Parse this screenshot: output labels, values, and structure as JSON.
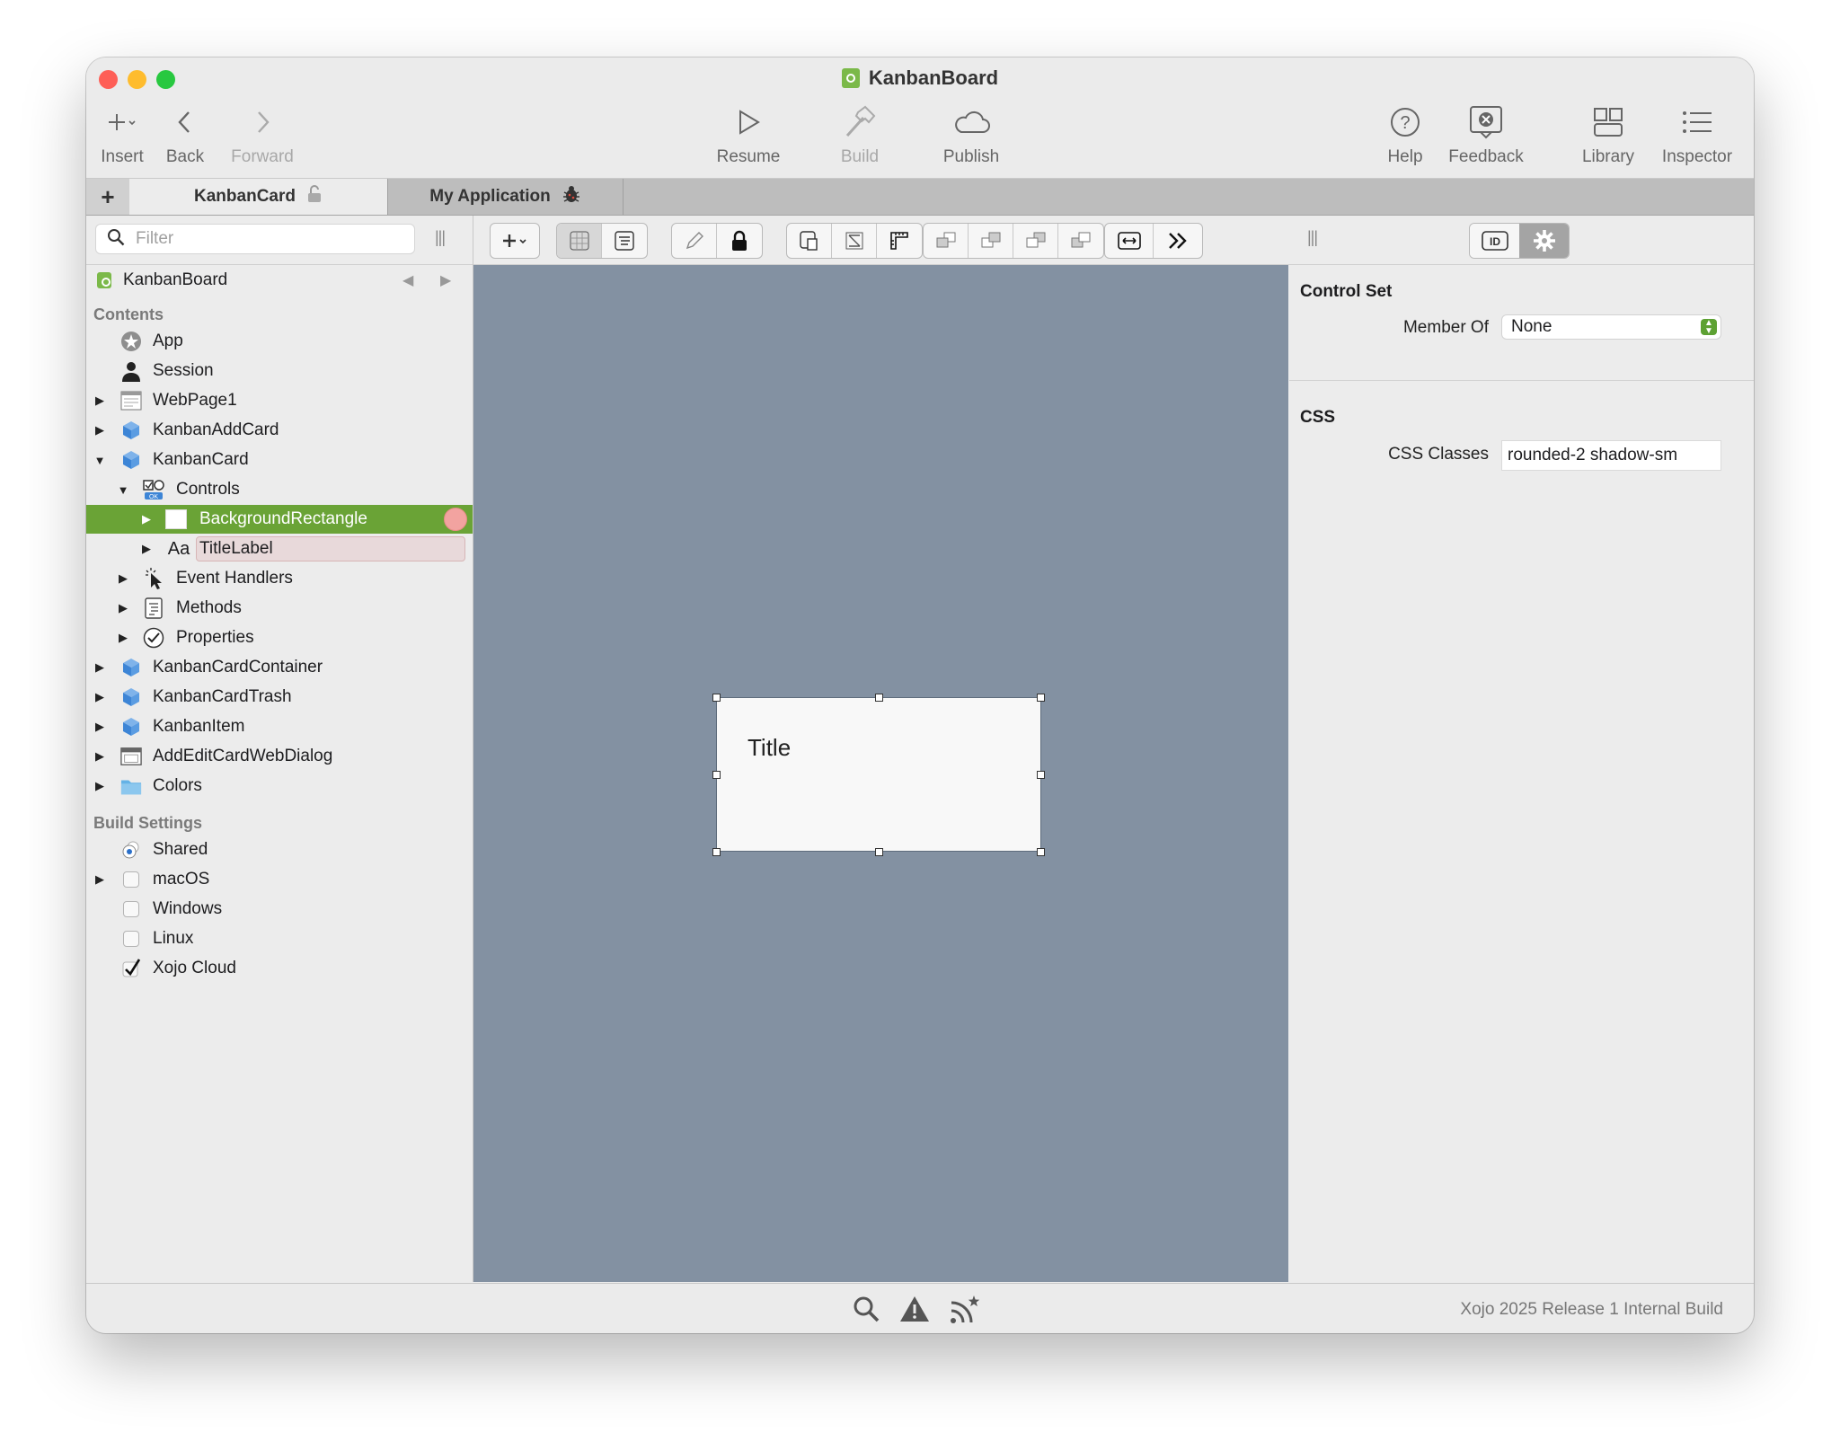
{
  "window": {
    "title": "KanbanBoard"
  },
  "colors": {
    "accent": "#6aa336",
    "canvas": "#8391a2",
    "close": "#fe5f57",
    "minimize": "#febc2e",
    "zoom": "#28c840",
    "row_marker": "#f2a3a0",
    "editing_row": "#e8d9da"
  },
  "toolbar": {
    "insert": "Insert",
    "back": "Back",
    "forward": "Forward",
    "resume": "Resume",
    "build": "Build",
    "publish": "Publish",
    "help": "Help",
    "feedback": "Feedback",
    "library": "Library",
    "inspector": "Inspector"
  },
  "tabs": {
    "add": "+",
    "items": [
      {
        "label": "KanbanCard",
        "icon": "lock-icon"
      },
      {
        "label": "My Application",
        "icon": "bug-icon"
      }
    ]
  },
  "sidebar": {
    "filter_placeholder": "Filter",
    "nav_title": "KanbanBoard",
    "contents_header": "Contents",
    "items": [
      {
        "label": "App",
        "icon": "app-icon"
      },
      {
        "label": "Session",
        "icon": "person-icon"
      },
      {
        "label": "WebPage1",
        "icon": "webpage-icon"
      },
      {
        "label": "KanbanAddCard",
        "icon": "cube-icon"
      },
      {
        "label": "KanbanCard",
        "icon": "cube-icon"
      },
      {
        "label": "Controls",
        "icon": "controls-icon"
      },
      {
        "label": "BackgroundRectangle",
        "icon": "rectangle-icon"
      },
      {
        "label": "TitleLabel",
        "icon": "Aa"
      },
      {
        "label": "Event Handlers",
        "icon": "event-icon"
      },
      {
        "label": "Methods",
        "icon": "methods-icon"
      },
      {
        "label": "Properties",
        "icon": "check-circle-icon"
      },
      {
        "label": "KanbanCardContainer",
        "icon": "cube-icon"
      },
      {
        "label": "KanbanCardTrash",
        "icon": "cube-icon"
      },
      {
        "label": "KanbanItem",
        "icon": "cube-icon"
      },
      {
        "label": "AddEditCardWebDialog",
        "icon": "dialog-icon"
      },
      {
        "label": "Colors",
        "icon": "folder-icon"
      }
    ],
    "build_header": "Build Settings",
    "build_items": [
      {
        "label": "Shared",
        "state": "radio-on"
      },
      {
        "label": "macOS",
        "state": "unchecked"
      },
      {
        "label": "Windows",
        "state": "unchecked"
      },
      {
        "label": "Linux",
        "state": "unchecked"
      },
      {
        "label": "Xojo Cloud",
        "state": "checked"
      }
    ]
  },
  "canvas": {
    "control_text": "Title"
  },
  "inspector": {
    "control_set_header": "Control Set",
    "member_of_label": "Member Of",
    "member_of_value": "None",
    "css_header": "CSS",
    "css_classes_label": "CSS Classes",
    "css_classes_value": "rounded-2 shadow-sm"
  },
  "status": {
    "version": "Xojo 2025 Release 1 Internal Build"
  }
}
